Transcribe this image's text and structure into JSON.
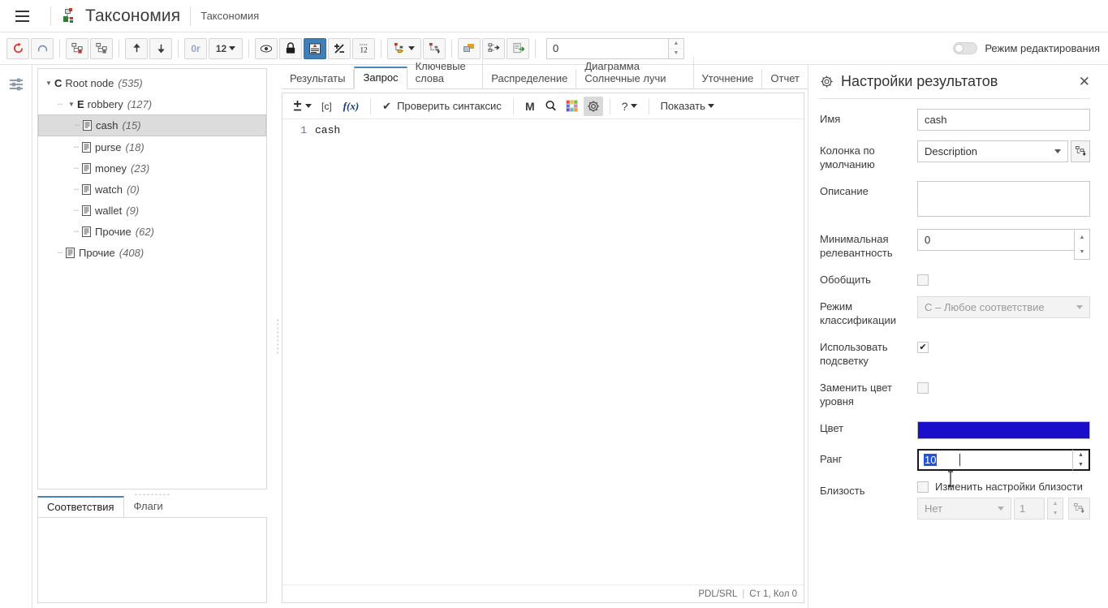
{
  "titlebar": {
    "menu_icon": "hamburger-icon",
    "logo_icon": "taxonomy-logo-icon",
    "app_title": "Таксономия",
    "doc_title": "Таксономия"
  },
  "toolbar": {
    "buttons": [
      {
        "name": "refresh",
        "icon": "refresh-icon",
        "tooltip": "Обновить"
      },
      {
        "name": "undo-circle",
        "icon": "circle-arrow-icon",
        "tooltip": ""
      },
      {
        "name": "add-node",
        "icon": "add-node-icon",
        "tooltip": ""
      },
      {
        "name": "remove-node",
        "icon": "remove-node-icon",
        "tooltip": ""
      },
      {
        "name": "move-up",
        "icon": "arrow-up-icon",
        "tooltip": ""
      },
      {
        "name": "move-down",
        "icon": "arrow-down-icon",
        "tooltip": ""
      },
      {
        "name": "or-operator",
        "icon": "or-text-icon",
        "label": "0r"
      },
      {
        "name": "level-select",
        "icon": "level-dropdown",
        "label": "12"
      },
      {
        "name": "preview-eye",
        "icon": "eye-icon"
      },
      {
        "name": "lock",
        "icon": "lock-icon"
      },
      {
        "name": "highlight",
        "icon": "highlight-icon"
      },
      {
        "name": "plus-minus",
        "icon": "plus-minus-icon"
      },
      {
        "name": "counter",
        "icon": "counter-12-icon"
      },
      {
        "name": "node-tools",
        "icon": "node-tools-icon"
      },
      {
        "name": "node-move",
        "icon": "node-move-icon"
      },
      {
        "name": "layers",
        "icon": "layers-icon"
      },
      {
        "name": "node-export",
        "icon": "node-export-icon"
      },
      {
        "name": "doc-export",
        "icon": "doc-export-icon"
      }
    ],
    "spin_value": "0",
    "edit_mode_label": "Режим редактирования",
    "edit_mode_on": false
  },
  "rail": {
    "filter_icon": "sliders-icon"
  },
  "tree": [
    {
      "level": 0,
      "kind": "C",
      "label": "Root node",
      "count": "(535)",
      "expanded": true,
      "selected": false,
      "icon": "class-icon"
    },
    {
      "level": 1,
      "kind": "E",
      "label": "robbery",
      "count": "(127)",
      "expanded": true,
      "selected": false,
      "icon": "entity-icon"
    },
    {
      "level": 2,
      "kind": "",
      "label": "cash",
      "count": "(15)",
      "expanded": null,
      "selected": true,
      "icon": "rule-icon"
    },
    {
      "level": 2,
      "kind": "",
      "label": "purse",
      "count": "(18)",
      "expanded": null,
      "selected": false,
      "icon": "rule-icon"
    },
    {
      "level": 2,
      "kind": "",
      "label": "money",
      "count": "(23)",
      "expanded": null,
      "selected": false,
      "icon": "rule-icon"
    },
    {
      "level": 2,
      "kind": "",
      "label": "watch",
      "count": "(0)",
      "expanded": null,
      "selected": false,
      "icon": "rule-icon"
    },
    {
      "level": 2,
      "kind": "",
      "label": "wallet",
      "count": "(9)",
      "expanded": null,
      "selected": false,
      "icon": "rule-icon"
    },
    {
      "level": 2,
      "kind": "",
      "label": "Прочие",
      "count": "(62)",
      "expanded": null,
      "selected": false,
      "icon": "rule-icon"
    },
    {
      "level": 1,
      "kind": "",
      "label": "Прочие",
      "count": "(408)",
      "expanded": null,
      "selected": false,
      "icon": "rule-icon"
    }
  ],
  "bottom_tabs": [
    {
      "label": "Соответствия",
      "active": true
    },
    {
      "label": "Флаги",
      "active": false
    }
  ],
  "tabs": [
    {
      "label": "Результаты",
      "active": false
    },
    {
      "label": "Запрос",
      "active": true
    },
    {
      "label": "Ключевые слова",
      "active": false
    },
    {
      "label": "Распределение",
      "active": false
    },
    {
      "label": "Диаграмма Солнечные лучи",
      "active": false
    },
    {
      "label": "Уточнение",
      "active": false
    },
    {
      "label": "Отчет",
      "active": false
    }
  ],
  "editor_toolbar": {
    "insert_icon": "plus-minus-insert-icon",
    "bracket_label": "[c]",
    "function_label": "f(x)",
    "check_syntax_label": "Проверить синтаксис",
    "check_icon": "checkmark-icon",
    "macro_label": "M",
    "search_icon": "zoom-search-icon",
    "palette_icon": "color-palette-icon",
    "gear_icon": "gear-icon",
    "help_label": "?",
    "show_label": "Показать"
  },
  "editor": {
    "line_number": "1",
    "code": "cash"
  },
  "status": {
    "language": "PDL/SRL",
    "separator": "|",
    "position": "Ст 1, Кол 0"
  },
  "settings": {
    "gear_icon": "gear-icon",
    "title": "Настройки результатов",
    "close_icon": "close-icon",
    "name_label": "Имя",
    "name_value": "cash",
    "default_column_label": "Колонка по умолчанию",
    "default_column_value": "Description",
    "default_column_picker_icon": "tree-picker-icon",
    "description_label": "Описание",
    "description_value": "",
    "min_relevance_label": "Минимальная релевантность",
    "min_relevance_value": "0",
    "generalize_label": "Обобщить",
    "generalize_checked": false,
    "classification_mode_label": "Режим классификации",
    "classification_mode_value": "C – Любое соответствие",
    "use_highlight_label": "Использовать подсветку",
    "use_highlight_checked": true,
    "replace_level_color_label": "Заменить цвет уровня",
    "replace_level_color_checked": false,
    "color_label": "Цвет",
    "color_value": "#1a0ecb",
    "rank_label": "Ранг",
    "rank_value": "10",
    "rank_selected": true,
    "proximity_label": "Близость",
    "proximity_checkbox_label": "Изменить настройки близости",
    "proximity_checked": false,
    "proximity_select_value": "Нет",
    "proximity_number_value": "1",
    "proximity_picker_icon": "tree-picker-icon"
  }
}
